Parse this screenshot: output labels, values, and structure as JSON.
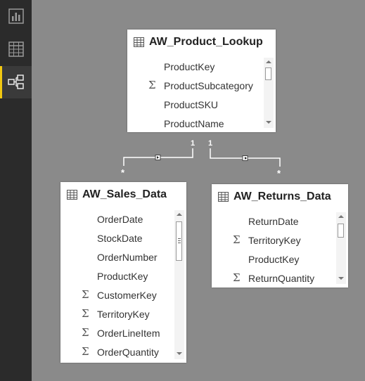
{
  "sidebar": {
    "items": [
      {
        "name": "report-view",
        "icon": "bar-chart-icon",
        "active": false
      },
      {
        "name": "data-view",
        "icon": "table-grid-icon",
        "active": false
      },
      {
        "name": "relationships-view",
        "icon": "relationships-icon",
        "active": true
      }
    ],
    "accent": "#f2c811"
  },
  "tables": {
    "product_lookup": {
      "title": "AW_Product_Lookup",
      "fields": [
        {
          "name": "ProductKey",
          "sum": false
        },
        {
          "name": "ProductSubcategory",
          "sum": true
        },
        {
          "name": "ProductSKU",
          "sum": false
        },
        {
          "name": "ProductName",
          "sum": false
        }
      ]
    },
    "sales_data": {
      "title": "AW_Sales_Data",
      "fields": [
        {
          "name": "OrderDate",
          "sum": false
        },
        {
          "name": "StockDate",
          "sum": false
        },
        {
          "name": "OrderNumber",
          "sum": false
        },
        {
          "name": "ProductKey",
          "sum": false
        },
        {
          "name": "CustomerKey",
          "sum": true
        },
        {
          "name": "TerritoryKey",
          "sum": true
        },
        {
          "name": "OrderLineItem",
          "sum": true
        },
        {
          "name": "OrderQuantity",
          "sum": true
        }
      ]
    },
    "returns_data": {
      "title": "AW_Returns_Data",
      "fields": [
        {
          "name": "ReturnDate",
          "sum": false
        },
        {
          "name": "TerritoryKey",
          "sum": true
        },
        {
          "name": "ProductKey",
          "sum": false
        },
        {
          "name": "ReturnQuantity",
          "sum": true
        }
      ]
    }
  },
  "relationships": {
    "sales": {
      "one": "1",
      "many": "*"
    },
    "returns": {
      "one": "1",
      "many": "*"
    }
  },
  "sigma_symbol": "Σ"
}
